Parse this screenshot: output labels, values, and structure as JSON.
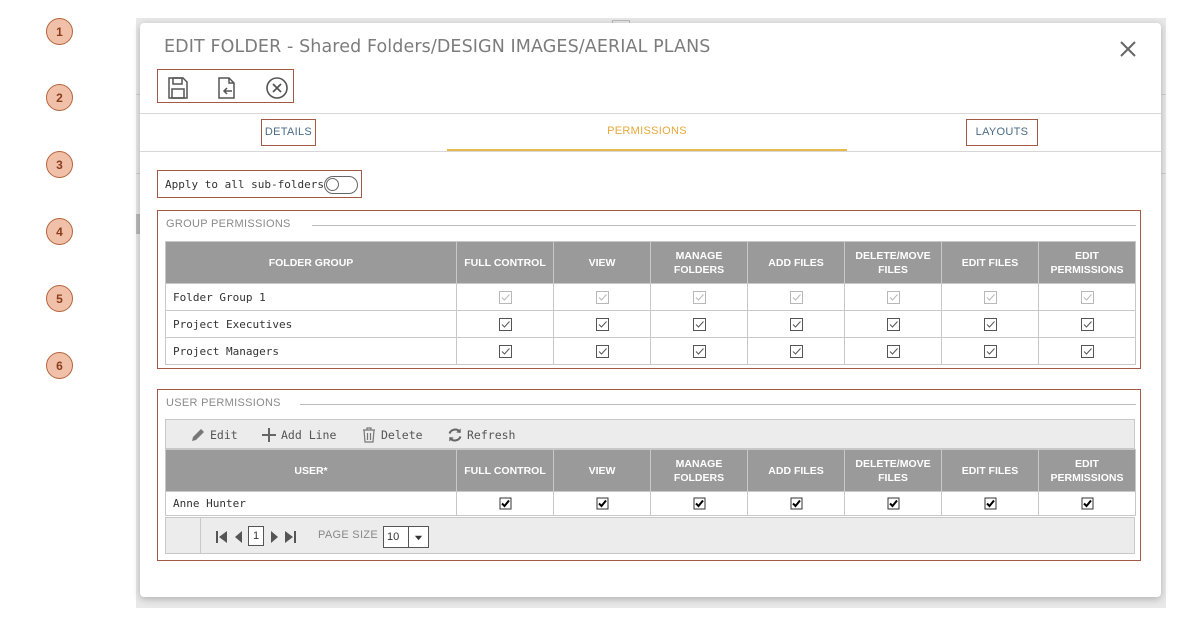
{
  "callouts": [
    "1",
    "2",
    "3",
    "4",
    "5",
    "6"
  ],
  "modal": {
    "title": "EDIT FOLDER - Shared Folders/DESIGN IMAGES/AERIAL PLANS",
    "toolbar_icons": [
      "save-icon",
      "save-and-close-icon",
      "cancel-icon"
    ],
    "close_icon": "close-icon"
  },
  "tabs": [
    {
      "label": "DETAILS",
      "active": false
    },
    {
      "label": "PERMISSIONS",
      "active": true
    },
    {
      "label": "LAYOUTS",
      "active": false
    }
  ],
  "colors": {
    "active_tab": "#e8a93a",
    "tab_text": "#4a6a85",
    "highlight_border": "#a35a45",
    "header_bg": "#9a9a9a"
  },
  "apply_all": {
    "label": "Apply to all sub-folders",
    "on": false
  },
  "group_permissions": {
    "legend": "GROUP PERMISSIONS",
    "columns": [
      "FOLDER GROUP",
      "FULL CONTROL",
      "VIEW",
      "MANAGE FOLDERS",
      "ADD FILES",
      "DELETE/MOVE FILES",
      "EDIT FILES",
      "EDIT PERMISSIONS"
    ],
    "rows": [
      {
        "name": "Folder Group 1",
        "checked": [
          true,
          true,
          true,
          true,
          true,
          true,
          true
        ],
        "disabled": true
      },
      {
        "name": "Project Executives",
        "checked": [
          true,
          true,
          true,
          true,
          true,
          true,
          true
        ],
        "disabled": false
      },
      {
        "name": "Project Managers",
        "checked": [
          true,
          true,
          true,
          true,
          true,
          true,
          true
        ],
        "disabled": false
      }
    ]
  },
  "user_permissions": {
    "legend": "USER PERMISSIONS",
    "toolbar": {
      "edit": "Edit",
      "add_line": "Add Line",
      "delete": "Delete",
      "refresh": "Refresh"
    },
    "columns": [
      "USER*",
      "FULL CONTROL",
      "VIEW",
      "MANAGE FOLDERS",
      "ADD FILES",
      "DELETE/MOVE FILES",
      "EDIT FILES",
      "EDIT PERMISSIONS"
    ],
    "rows": [
      {
        "name": "Anne Hunter",
        "checked": [
          true,
          true,
          true,
          true,
          true,
          true,
          true
        ]
      }
    ],
    "pager": {
      "page": "1",
      "page_size_label": "PAGE SIZE",
      "page_size": "10"
    }
  }
}
